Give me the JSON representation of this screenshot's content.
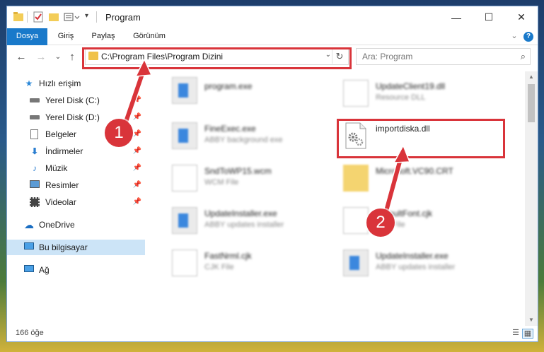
{
  "window": {
    "title": "Program",
    "controls": {
      "minimize": "—",
      "maximize": "☐",
      "close": "✕"
    }
  },
  "ribbon": {
    "tabs": [
      {
        "label": "Dosya"
      },
      {
        "label": "Giriş"
      },
      {
        "label": "Paylaş"
      },
      {
        "label": "Görünüm"
      }
    ],
    "collapse": "⌄",
    "help": "?"
  },
  "nav": {
    "back": "←",
    "forward": "→",
    "recent": "⌄",
    "up": "↑",
    "address": "C:\\Program Files\\Program Dizini",
    "search_placeholder": "Ara: Program"
  },
  "sidebar": {
    "items": [
      {
        "label": "Hızlı erişim",
        "icon": "star-icon",
        "pinned": false
      },
      {
        "label": "Yerel Disk (C:)",
        "icon": "drive-icon",
        "pinned": true
      },
      {
        "label": "Yerel Disk (D:)",
        "icon": "drive-icon",
        "pinned": true
      },
      {
        "label": "Belgeler",
        "icon": "documents-icon",
        "pinned": true
      },
      {
        "label": "İndirmeler",
        "icon": "download-icon",
        "pinned": true
      },
      {
        "label": "Müzik",
        "icon": "music-icon",
        "pinned": true
      },
      {
        "label": "Resimler",
        "icon": "pictures-icon",
        "pinned": true
      },
      {
        "label": "Videolar",
        "icon": "video-icon",
        "pinned": true
      },
      {
        "label": "OneDrive",
        "icon": "cloud-icon",
        "pinned": false
      },
      {
        "label": "Bu bilgisayar",
        "icon": "computer-icon",
        "pinned": false,
        "selected": true
      },
      {
        "label": "Ağ",
        "icon": "network-icon",
        "pinned": false
      }
    ]
  },
  "files": [
    {
      "name": "program.exe",
      "desc": "",
      "icon": "exe-icon"
    },
    {
      "name": "UpdateClient19.dll",
      "desc": "Resource DLL",
      "icon": "dll-icon"
    },
    {
      "name": "FineExec.exe",
      "desc": "ABBY background exe",
      "icon": "exe-icon"
    },
    {
      "name": "importdiska.dll",
      "desc": "",
      "icon": "dll-gear-icon"
    },
    {
      "name": "SndToWP15.wcm",
      "desc": "WCM File",
      "icon": "file-icon"
    },
    {
      "name": "Microsoft.VC90.CRT",
      "desc": "",
      "icon": "folder-icon"
    },
    {
      "name": "UpdateInstaller.exe",
      "desc": "ABBY updates installer",
      "icon": "exe-icon"
    },
    {
      "name": "DefaultFont.cjk",
      "desc": "CJK File",
      "icon": "file-icon"
    },
    {
      "name": "FastNrml.cjk",
      "desc": "CJK File",
      "icon": "file-icon"
    },
    {
      "name": "UpdateInstaller.exe",
      "desc": "ABBY updates installer",
      "icon": "exe-icon"
    }
  ],
  "status": {
    "count": "166 öğe"
  },
  "callouts": {
    "one": "1",
    "two": "2"
  },
  "colors": {
    "accent": "#1979ca",
    "highlight": "#d9343a",
    "selection": "#cce4f7"
  }
}
